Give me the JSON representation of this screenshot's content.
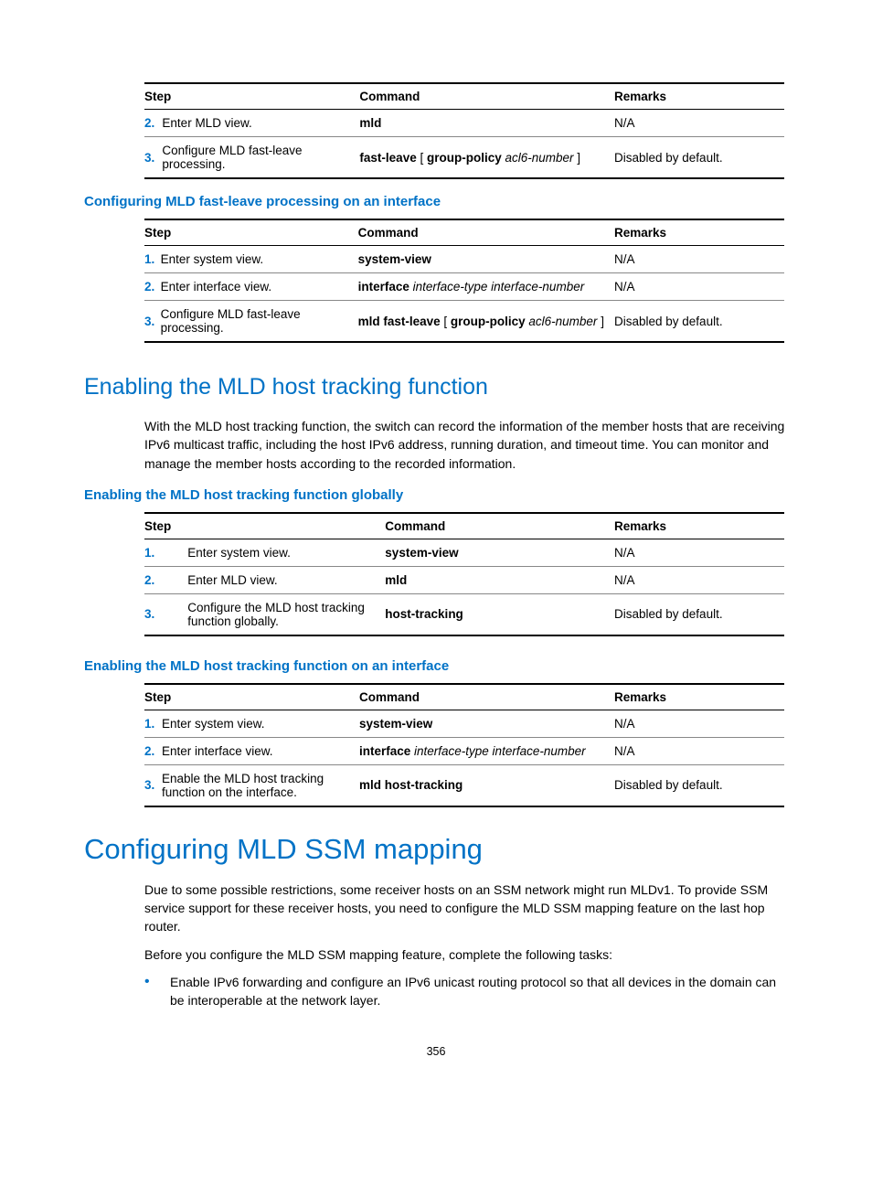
{
  "table1": {
    "headers": {
      "step": "Step",
      "command": "Command",
      "remarks": "Remarks"
    },
    "rows": [
      {
        "num": "2.",
        "desc": "Enter MLD view.",
        "cmd_b": "mld",
        "cmd_rest": "",
        "rem": "N/A"
      },
      {
        "num": "3.",
        "desc": "Configure MLD fast-leave processing.",
        "cmd_b": "fast-leave",
        "cmd_plain1": " [ ",
        "cmd_b2": "group-policy",
        "cmd_i": " acl6-number",
        "cmd_plain2": " ]",
        "rem": "Disabled by default."
      }
    ]
  },
  "h3_1": "Configuring MLD fast-leave processing on an interface",
  "table2": {
    "headers": {
      "step": "Step",
      "command": "Command",
      "remarks": "Remarks"
    },
    "rows": [
      {
        "num": "1.",
        "desc": "Enter system view.",
        "cmd_b": "system-view",
        "rem": "N/A"
      },
      {
        "num": "2.",
        "desc": "Enter interface view.",
        "cmd_b": "interface",
        "cmd_i": " interface-type interface-number",
        "rem": "N/A"
      },
      {
        "num": "3.",
        "desc": "Configure MLD fast-leave processing.",
        "cmd_b": "mld fast-leave",
        "cmd_plain1": " [ ",
        "cmd_b2": "group-policy",
        "cmd_i": " acl6-number",
        "cmd_plain2": " ]",
        "rem": "Disabled by default."
      }
    ]
  },
  "h2_1": "Enabling the MLD host tracking function",
  "para1": "With the MLD host tracking function, the switch can record the information of the member hosts that are receiving IPv6 multicast traffic, including the host IPv6 address, running duration, and timeout time. You can monitor and manage the member hosts according to the recorded information.",
  "h3_2": "Enabling the MLD host tracking function globally",
  "table3": {
    "headers": {
      "step": "Step",
      "command": "Command",
      "remarks": "Remarks"
    },
    "rows": [
      {
        "num": "1.",
        "desc": "Enter system view.",
        "cmd_b": "system-view",
        "rem": "N/A"
      },
      {
        "num": "2.",
        "desc": "Enter MLD view.",
        "cmd_b": "mld",
        "rem": "N/A"
      },
      {
        "num": "3.",
        "desc": "Configure the MLD host tracking function globally.",
        "cmd_b": "host-tracking",
        "rem": "Disabled by default."
      }
    ]
  },
  "h3_3": "Enabling the MLD host tracking function on an interface",
  "table4": {
    "headers": {
      "step": "Step",
      "command": "Command",
      "remarks": "Remarks"
    },
    "rows": [
      {
        "num": "1.",
        "desc": "Enter system view.",
        "cmd_b": "system-view",
        "rem": "N/A"
      },
      {
        "num": "2.",
        "desc": "Enter interface view.",
        "cmd_b": "interface",
        "cmd_i": " interface-type interface-number",
        "rem": "N/A"
      },
      {
        "num": "3.",
        "desc": "Enable the MLD host tracking function on the interface.",
        "cmd_b": "mld host-tracking",
        "rem": "Disabled by default."
      }
    ]
  },
  "h1_1": "Configuring MLD SSM mapping",
  "para2": "Due to some possible restrictions, some receiver hosts on an SSM network might run MLDv1. To provide SSM service support for these receiver hosts, you need to configure the MLD SSM mapping feature on the last hop router.",
  "para3": "Before you configure the MLD SSM mapping feature, complete the following tasks:",
  "bullet1": "Enable IPv6 forwarding and configure an IPv6 unicast routing protocol so that all devices in the domain can be interoperable at the network layer.",
  "pagenum": "356"
}
